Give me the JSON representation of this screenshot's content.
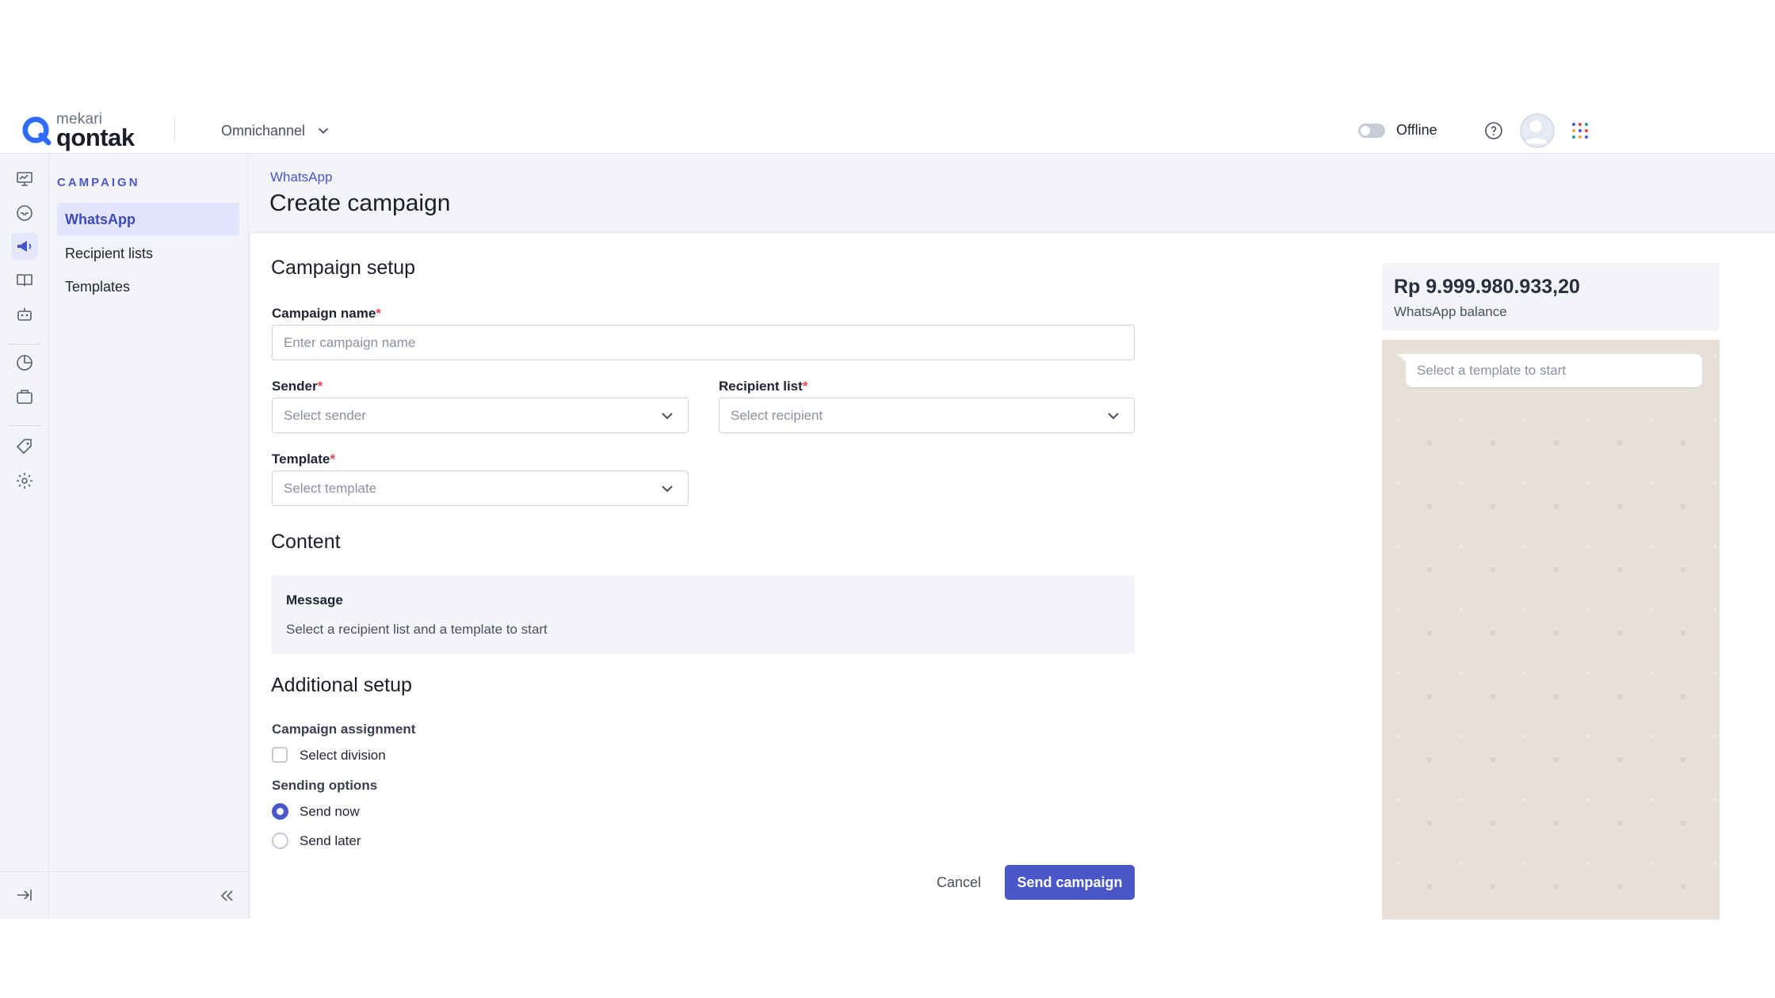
{
  "header": {
    "logo_top": "mekari",
    "logo_bottom": "qontak",
    "workspace_switcher": "Omnichannel",
    "status_label": "Offline"
  },
  "sidebar": {
    "section_title": "CAMPAIGN",
    "items": [
      {
        "label": "WhatsApp",
        "active": true
      },
      {
        "label": "Recipient lists",
        "active": false
      },
      {
        "label": "Templates",
        "active": false
      }
    ]
  },
  "page": {
    "breadcrumb": "WhatsApp",
    "title": "Create campaign"
  },
  "form": {
    "setup_heading": "Campaign setup",
    "campaign_name_label": "Campaign name",
    "campaign_name_placeholder": "Enter campaign name",
    "sender_label": "Sender",
    "sender_placeholder": "Select sender",
    "recipient_label": "Recipient list",
    "recipient_placeholder": "Select recipient",
    "template_label": "Template",
    "template_placeholder": "Select template",
    "required_mark": "*",
    "content_heading": "Content",
    "message_title": "Message",
    "message_text": "Select a recipient list and a template to start",
    "additional_heading": "Additional setup",
    "assignment_label": "Campaign assignment",
    "division_option": "Select division",
    "sending_label": "Sending options",
    "send_now": "Send now",
    "send_later": "Send later",
    "selected_sending_option": "Send now",
    "cancel_button": "Cancel",
    "send_button": "Send campaign"
  },
  "balance": {
    "amount": "Rp 9.999.980.933,20",
    "label": "WhatsApp balance"
  },
  "preview": {
    "bubble_text": "Select a template to start"
  },
  "colors": {
    "accent": "#4a57c9",
    "required": "#e5484d",
    "background": "#f3f4f8"
  }
}
